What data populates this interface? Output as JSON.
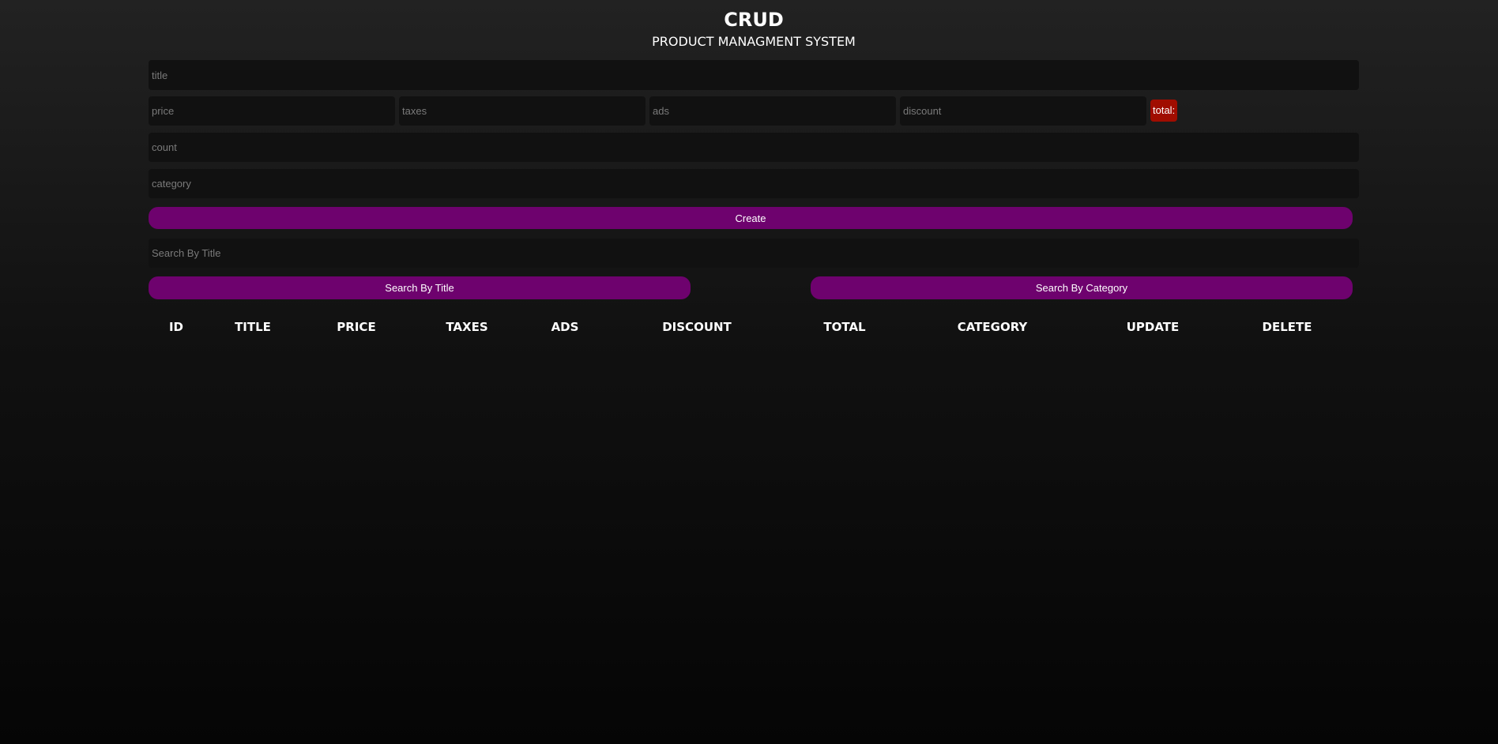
{
  "header": {
    "title": "CRUD",
    "subtitle": "PRODUCT MANAGMENT SYSTEM"
  },
  "inputs": {
    "title_placeholder": "title",
    "price_placeholder": "price",
    "taxes_placeholder": "taxes",
    "ads_placeholder": "ads",
    "discount_placeholder": "discount",
    "count_placeholder": "count",
    "category_placeholder": "category",
    "search_placeholder": "Search By Title"
  },
  "total": {
    "label": "total:",
    "color": "#a00d00"
  },
  "buttons": {
    "create": "Create",
    "search_title": "Search By Title",
    "search_category": "Search By Category",
    "color": "#6e026e"
  },
  "table": {
    "columns": [
      "ID",
      "TITLE",
      "PRICE",
      "TAXES",
      "ADS",
      "DISCOUNT",
      "TOTAL",
      "CATEGORY",
      "UPDATE",
      "DELETE"
    ],
    "rows": []
  }
}
